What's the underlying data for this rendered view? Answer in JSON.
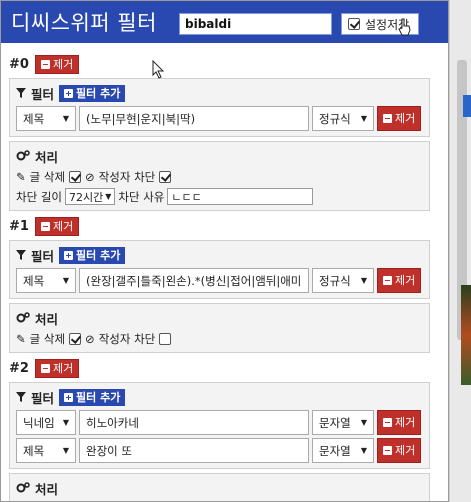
{
  "header": {
    "title": "디씨스위퍼 필터",
    "search_value": "bibaldi",
    "save_label": "설정저장",
    "save_checked": true
  },
  "labels": {
    "remove": "제거",
    "filter": "필터",
    "add_filter": "필터 추가",
    "process": "처리",
    "delete_post": "글 삭제",
    "block_author": "작성자 차단",
    "ban_length": "차단 길이",
    "ban_reason": "차단 사유"
  },
  "rules": [
    {
      "id": "#0",
      "filters": [
        {
          "field": "제목",
          "value": "(노무|무현|운지|북|딱)",
          "mode": "정규식"
        }
      ],
      "delete_checked": true,
      "block_checked": true,
      "ban_length": "72시간",
      "ban_reason": "ㄴㄷㄷ"
    },
    {
      "id": "#1",
      "filters": [
        {
          "field": "제목",
          "value": "(완장|갤주|틀죽|왼손).*(병신|접어|앰뒤|애미",
          "mode": "정규식"
        }
      ],
      "delete_checked": true,
      "block_checked": false
    },
    {
      "id": "#2",
      "filters": [
        {
          "field": "닉네임",
          "value": "히노아카네",
          "mode": "문자열"
        },
        {
          "field": "제목",
          "value": "완장이 또",
          "mode": "문자열"
        }
      ],
      "delete_checked": true,
      "block_checked": true
    }
  ]
}
